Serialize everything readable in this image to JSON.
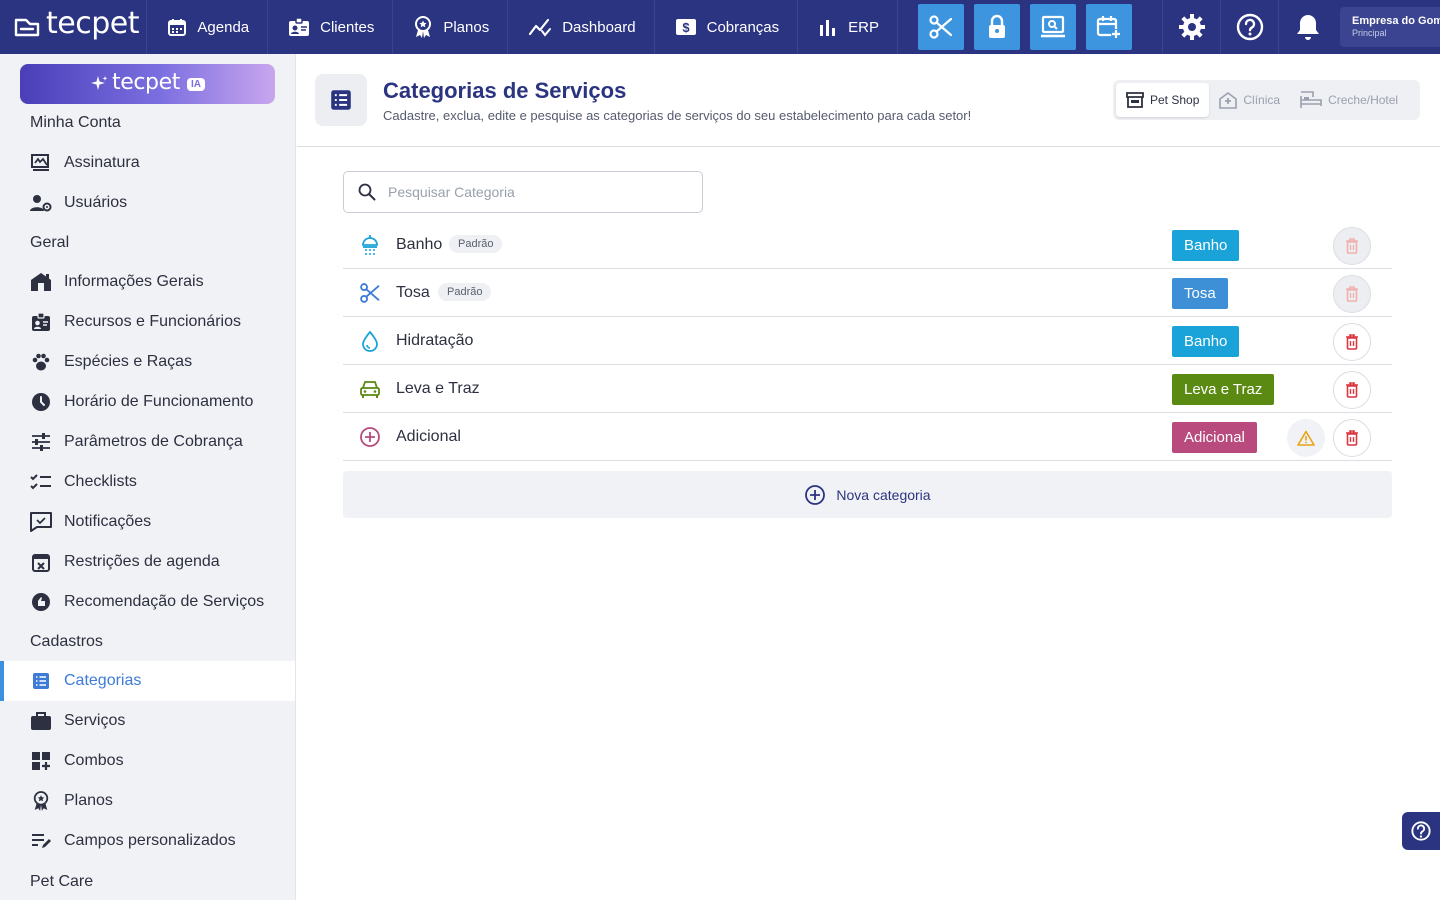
{
  "brand": {
    "name": "tecpet"
  },
  "nav": [
    {
      "label": "Agenda",
      "icon": "calendar-icon"
    },
    {
      "label": "Clientes",
      "icon": "id-card-icon"
    },
    {
      "label": "Planos",
      "icon": "award-icon"
    },
    {
      "label": "Dashboard",
      "icon": "chart-line-icon"
    },
    {
      "label": "Cobranças",
      "icon": "dollar-icon"
    },
    {
      "label": "ERP",
      "icon": "bar-chart-icon"
    }
  ],
  "tools": [
    "scissors-icon",
    "lock-icon",
    "monitor-search-icon",
    "calendar-plus-icon"
  ],
  "top_right": [
    "gear-icon",
    "help-icon",
    "bell-icon"
  ],
  "company": {
    "name": "Empresa do Gomes",
    "branch": "Principal"
  },
  "sidebar": {
    "ia_label": "tecpet",
    "ia_badge": "IA",
    "sections": [
      {
        "title": "Minha Conta",
        "items": [
          {
            "label": "Assinatura",
            "icon": "signature-icon"
          },
          {
            "label": "Usuários",
            "icon": "users-gear-icon"
          }
        ]
      },
      {
        "title": "Geral",
        "items": [
          {
            "label": "Informações Gerais",
            "icon": "store-icon"
          },
          {
            "label": "Recursos e Funcionários",
            "icon": "id-badge-icon"
          },
          {
            "label": "Espécies e Raças",
            "icon": "paw-icon"
          },
          {
            "label": "Horário de Funcionamento",
            "icon": "clock-icon"
          },
          {
            "label": "Parâmetros de Cobrança",
            "icon": "sliders-icon"
          },
          {
            "label": "Checklists",
            "icon": "checklist-icon"
          },
          {
            "label": "Notificações",
            "icon": "notification-icon"
          },
          {
            "label": "Restrições de agenda",
            "icon": "calendar-x-icon"
          },
          {
            "label": "Recomendação de Serviços",
            "icon": "recommend-icon"
          }
        ]
      },
      {
        "title": "Cadastros",
        "items": [
          {
            "label": "Categorias",
            "icon": "list-icon",
            "active": true
          },
          {
            "label": "Serviços",
            "icon": "briefcase-icon"
          },
          {
            "label": "Combos",
            "icon": "grid-plus-icon"
          },
          {
            "label": "Planos",
            "icon": "award-icon"
          },
          {
            "label": "Campos personalizados",
            "icon": "edit-list-icon"
          }
        ]
      },
      {
        "title": "Pet Care",
        "items": []
      }
    ]
  },
  "page": {
    "title": "Categorias de Serviços",
    "subtitle": "Cadastre, exclua, edite e pesquise as categorias de serviços do seu estabelecimento para cada setor!",
    "sectors": [
      {
        "label": "Pet Shop",
        "icon": "store-front-icon",
        "active": true
      },
      {
        "label": "Clínica",
        "icon": "clinic-icon",
        "active": false
      },
      {
        "label": "Creche/Hotel",
        "icon": "hotel-icon",
        "active": false
      }
    ],
    "search_placeholder": "Pesquisar Categoria",
    "search_value": "",
    "default_badge": "Padrão",
    "new_category_label": "Nova categoria"
  },
  "categories": [
    {
      "name": "Banho",
      "icon": "shower-icon",
      "icon_color": "#1aa3d9",
      "default": true,
      "tag": "Banho",
      "tag_color": "#1aa3d9",
      "deletable": false,
      "warning": false
    },
    {
      "name": "Tosa",
      "icon": "scissors-icon",
      "icon_color": "#3d7bd6",
      "default": true,
      "tag": "Tosa",
      "tag_color": "#3d8fd6",
      "deletable": false,
      "warning": false
    },
    {
      "name": "Hidratação",
      "icon": "drop-icon",
      "icon_color": "#1aa3d9",
      "default": false,
      "tag": "Banho",
      "tag_color": "#1aa3d9",
      "deletable": true,
      "warning": false
    },
    {
      "name": "Leva e Traz",
      "icon": "car-icon",
      "icon_color": "#5a8a12",
      "default": false,
      "tag": "Leva e Traz",
      "tag_color": "#5a8a12",
      "deletable": true,
      "warning": false
    },
    {
      "name": "Adicional",
      "icon": "plus-circle-icon",
      "icon_color": "#b84a7d",
      "default": false,
      "tag": "Adicional",
      "tag_color": "#b84a7d",
      "deletable": true,
      "warning": true
    }
  ]
}
